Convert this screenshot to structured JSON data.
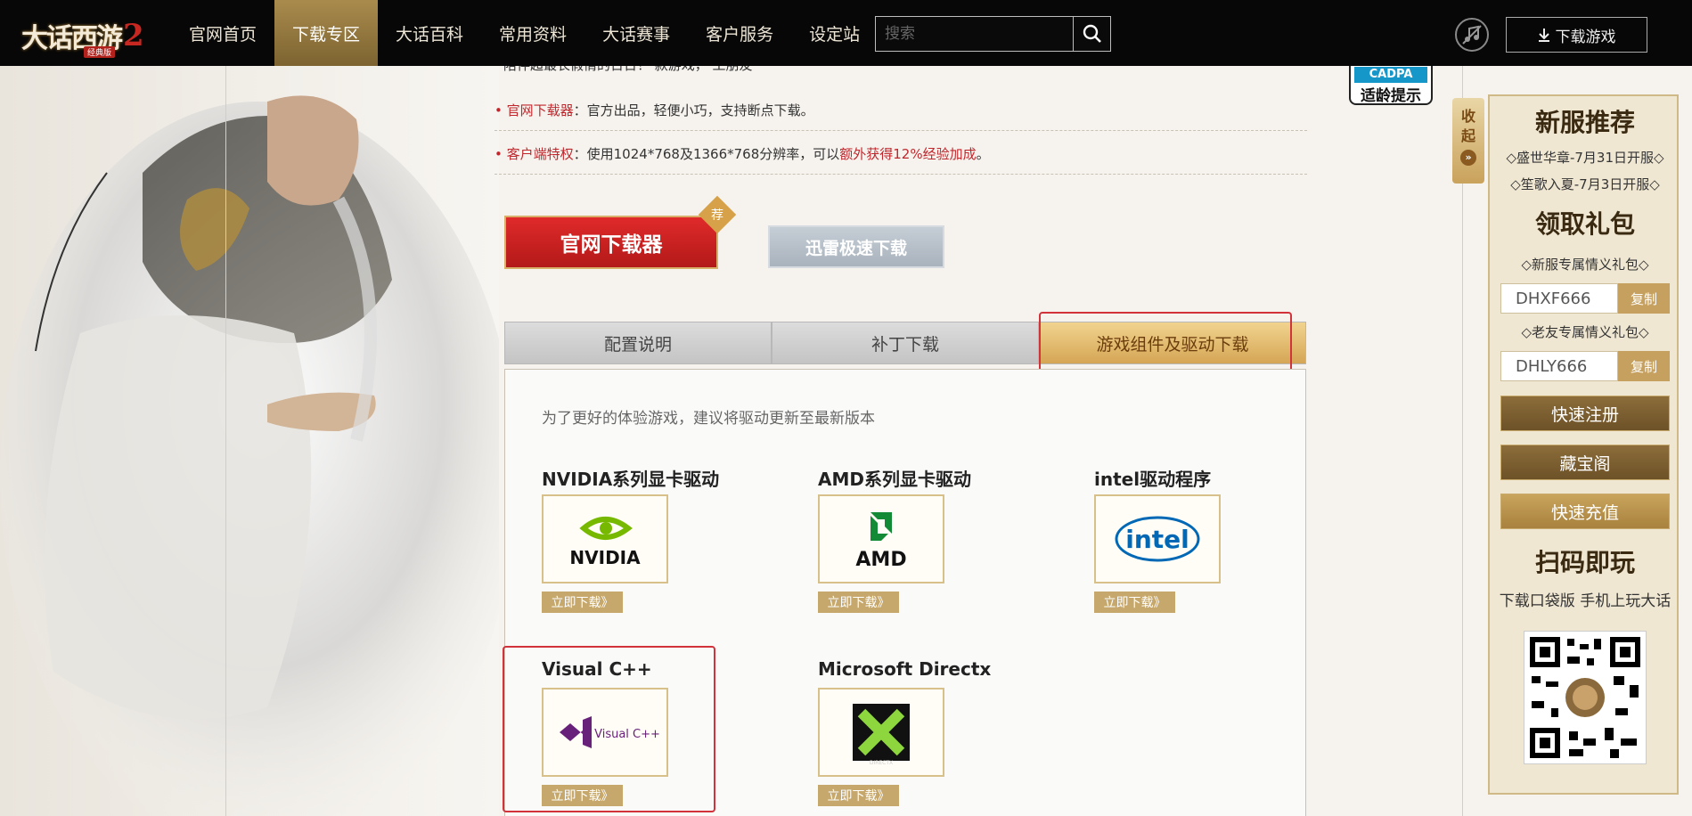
{
  "header": {
    "logo_text": "大话西游",
    "logo_num": "2",
    "logo_sub": "经典版",
    "nav": [
      {
        "label": "官网首页",
        "active": false
      },
      {
        "label": "下载专区",
        "active": true
      },
      {
        "label": "大话百科",
        "active": false
      },
      {
        "label": "常用资料",
        "active": false
      },
      {
        "label": "大话赛事",
        "active": false
      },
      {
        "label": "客户服务",
        "active": false
      },
      {
        "label": "设定站",
        "active": false
      }
    ],
    "search_placeholder": "搜索",
    "download_game_label": "下载游戏"
  },
  "intro": {
    "top_text": "陪伴超最长假情的日日！  款游戏，  工朋友",
    "features": [
      {
        "label": "官网下载器",
        "text": "：官方出品，轻便小巧，支持断点下载。",
        "highlight": "",
        "tail": ""
      },
      {
        "label": "客户端特权",
        "text": "：使用1024*768及1366*768分辨率，可以",
        "highlight": "额外获得12%经验加成",
        "tail": "。"
      }
    ]
  },
  "download_buttons": {
    "official": "官网下载器",
    "recommend_badge": "荐",
    "xunlei": "迅雷极速下载"
  },
  "tabs": [
    {
      "label": "配置说明",
      "active": false
    },
    {
      "label": "补丁下载",
      "active": false
    },
    {
      "label": "游戏组件及驱动下载",
      "active": true
    }
  ],
  "panel": {
    "hint": "为了更好的体验游戏，建议将驱动更新至最新版本",
    "drivers": [
      {
        "title": "NVIDIA系列显卡驱动",
        "logo": "NVIDIA",
        "download": "立即下载》"
      },
      {
        "title": "AMD系列显卡驱动",
        "logo": "AMD",
        "download": "立即下载》"
      },
      {
        "title": "intel驱动程序",
        "logo": "intel",
        "download": "立即下载》"
      },
      {
        "title": "Visual C++",
        "logo": "Visual C++",
        "download": "立即下载》"
      },
      {
        "title": "Microsoft Directx",
        "logo": "DIRECTX",
        "download": "立即下载》"
      }
    ]
  },
  "cadpa": {
    "top": "CADPA",
    "bottom": "适龄提示"
  },
  "sidebar": {
    "collapse": [
      "收",
      "起"
    ],
    "new_server_title": "新服推荐",
    "servers": [
      "◇盛世华章-7月31日开服◇",
      "◇笙歌入夏-7月3日开服◇"
    ],
    "gift_title": "领取礼包",
    "gifts": [
      {
        "label": "◇新服专属情义礼包◇",
        "code": "DHXF666",
        "copy": "复制"
      },
      {
        "label": "◇老友专属情义礼包◇",
        "code": "DHLY666",
        "copy": "复制"
      }
    ],
    "buttons": [
      "快速注册",
      "藏宝阁",
      "快速充值"
    ],
    "scan_title": "扫码即玩",
    "scan_sub": "下载口袋版 手机上玩大话"
  },
  "colors": {
    "accent_gold": "#c6a86d",
    "nav_active": "#8f733c",
    "highlight_red": "#c0272d",
    "annotation_red": "#d2333b"
  }
}
